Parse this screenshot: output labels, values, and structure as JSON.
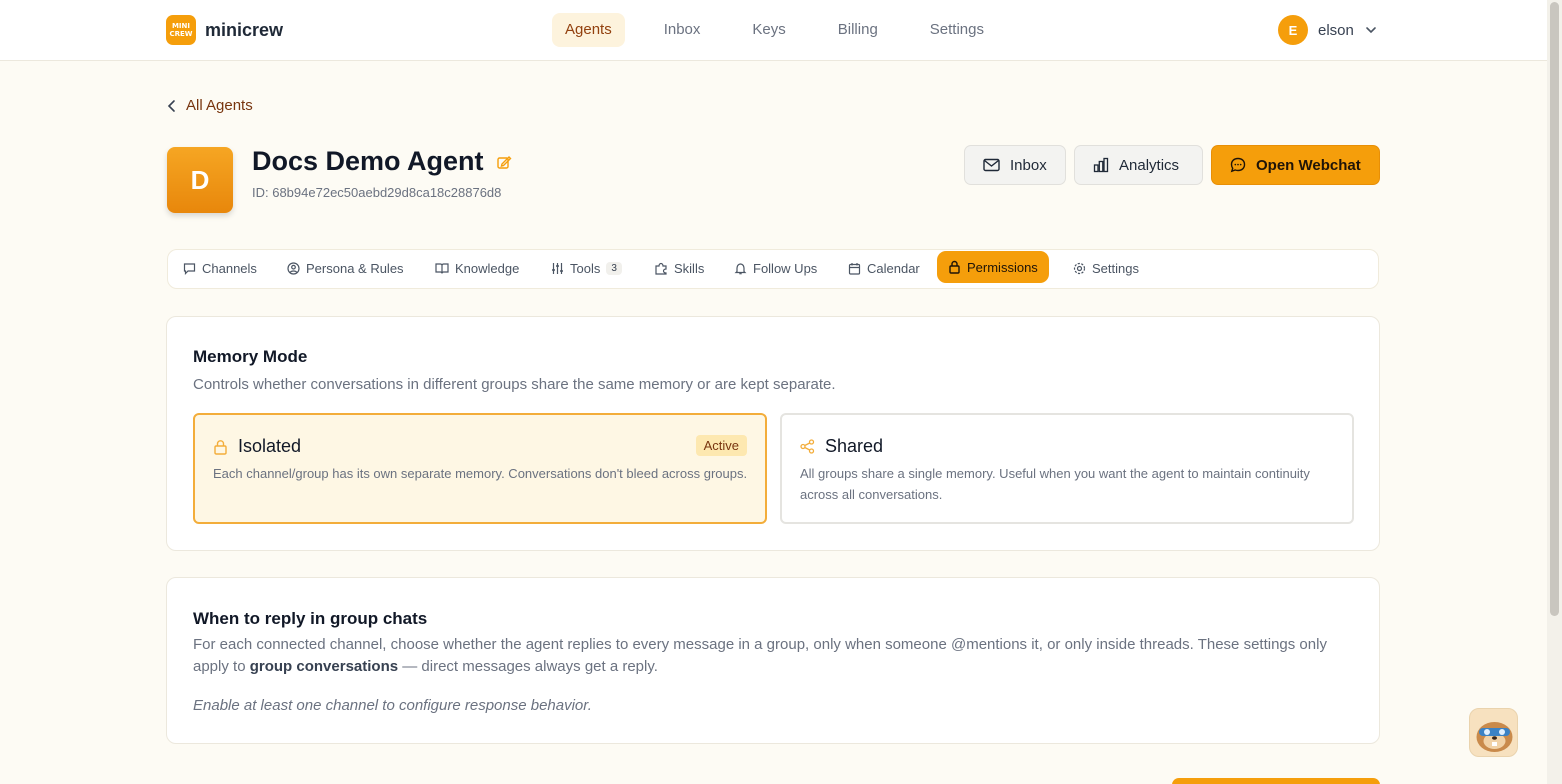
{
  "app": {
    "logo_text": [
      "MINI",
      "CREW"
    ],
    "name": "minicrew"
  },
  "nav": {
    "items": [
      "Agents",
      "Inbox",
      "Keys",
      "Billing",
      "Settings"
    ],
    "active": "Agents"
  },
  "user": {
    "initial": "E",
    "name": "elson"
  },
  "breadcrumb": {
    "back_label": "All Agents"
  },
  "agent": {
    "initial": "D",
    "name": "Docs Demo Agent",
    "id_text": "ID: 68b94e72ec50aebd29d8ca18c28876d8"
  },
  "actions": {
    "inbox": "Inbox",
    "analytics": "Analytics",
    "webchat": "Open Webchat"
  },
  "tabs": [
    {
      "label": "Channels",
      "icon": "chat-icon"
    },
    {
      "label": "Persona & Rules",
      "icon": "user-circle-icon"
    },
    {
      "label": "Knowledge",
      "icon": "book-icon"
    },
    {
      "label": "Tools",
      "icon": "sliders-icon",
      "badge": "3"
    },
    {
      "label": "Skills",
      "icon": "puzzle-icon"
    },
    {
      "label": "Follow Ups",
      "icon": "bell-icon"
    },
    {
      "label": "Calendar",
      "icon": "calendar-icon"
    },
    {
      "label": "Permissions",
      "icon": "lock-icon",
      "active": true
    },
    {
      "label": "Settings",
      "icon": "gear-icon"
    }
  ],
  "memory": {
    "title": "Memory Mode",
    "description": "Controls whether conversations in different groups share the same memory or are kept separate.",
    "options": [
      {
        "title": "Isolated",
        "badge": "Active",
        "description": "Each channel/group has its own separate memory. Conversations don't bleed across groups."
      },
      {
        "title": "Shared",
        "description": "All groups share a single memory. Useful when you want the agent to maintain continuity across all conversations."
      }
    ]
  },
  "group_reply": {
    "title": "When to reply in group chats",
    "description_1": "For each connected channel, choose whether the agent replies to every message in a group, only when someone @mentions it, or only inside threads. These settings only apply to",
    "description_bold": "group conversations",
    "description_2": "— direct messages always get a reply.",
    "note": "Enable at least one channel to configure response behavior."
  },
  "colors": {
    "accent": "#f59e0b",
    "background": "#fdfbf4",
    "active_nav_bg": "#fdf3dd"
  }
}
